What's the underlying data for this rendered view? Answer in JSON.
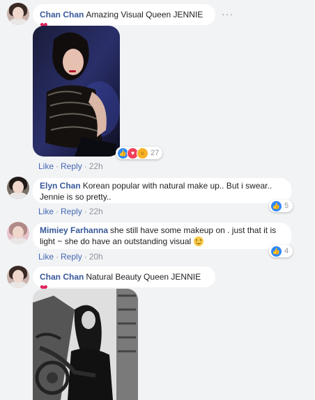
{
  "comments": [
    {
      "author": "Chan Chan",
      "text": "Amazing Visual Queen JENNIE",
      "emoji": "heart-icon",
      "actions": {
        "like": "Like",
        "reply": "Reply",
        "time": "22h"
      },
      "reactions": {
        "types": [
          "like",
          "love",
          "wow"
        ],
        "count": "27"
      },
      "more": "···"
    },
    {
      "author": "Elyn Chan",
      "text": "Korean popular with natural make up.. But i swear.. Jennie is so pretty..",
      "actions": {
        "like": "Like",
        "reply": "Reply",
        "time": "22h"
      },
      "reactions": {
        "types": [
          "like"
        ],
        "count": "5"
      }
    },
    {
      "author": "Mimiey Farhanna",
      "text": "she still have some makeup on . just that it is light ~ she do have an outstanding visual",
      "emoji": "smile-emoji",
      "actions": {
        "like": "Like",
        "reply": "Reply",
        "time": "20h"
      },
      "reactions": {
        "types": [
          "like"
        ],
        "count": "4"
      }
    },
    {
      "author": "Chan Chan",
      "text": "Natural Beauty Queen JENNIE",
      "emoji": "heart-icon"
    }
  ],
  "colors": {
    "link": "#385898",
    "action": "#4267b2",
    "heart": "#e0245e",
    "background": "#f2f3f5"
  }
}
